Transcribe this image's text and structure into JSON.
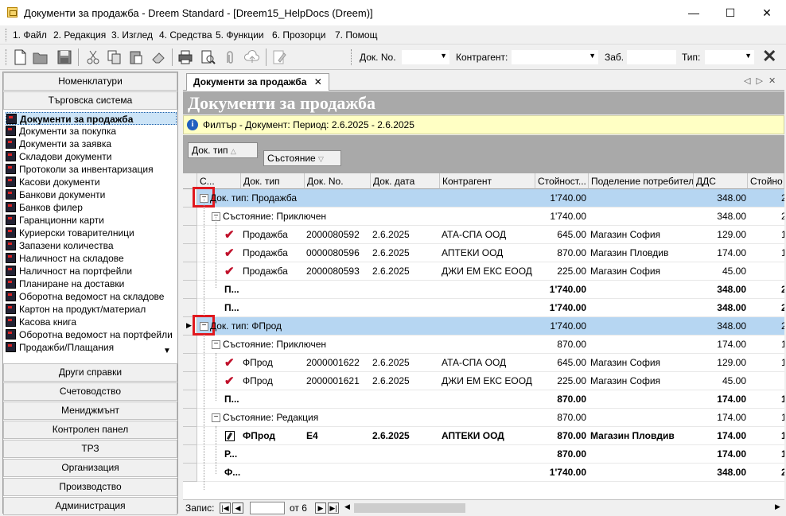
{
  "window": {
    "title": "Документи за продажба - Dreem Standard - [Dreem15_HelpDocs (Dreem)]",
    "minimize": "—",
    "maximize": "☐",
    "close": "✕"
  },
  "menu": [
    "1. Файл",
    "2. Редакция",
    "3. Изглед",
    "4. Средства",
    "5. Функции",
    "6. Прозорци",
    "7. Помощ"
  ],
  "toolbar": {
    "icons": [
      "new-document-icon",
      "open-folder-icon",
      "save-icon",
      "cut-icon",
      "copy-icon",
      "paste-icon",
      "eraser-icon",
      "print-icon",
      "print-preview-icon",
      "attach-icon",
      "cloud-upload-icon",
      "edit-doc-icon"
    ],
    "doc_no_label": "Док. No.",
    "contragent_label": "Контрагент:",
    "zab_label": "Заб.",
    "type_label": "Тип:",
    "clear": "✕"
  },
  "leftpane": {
    "top_buttons": [
      "Номенклатури",
      "Търговска система"
    ],
    "items": [
      "Документи за продажба",
      "Документи за покупка",
      "Документи за заявка",
      "Складови документи",
      "Протоколи за инвентаризация",
      "Касови документи",
      "Банкови документи",
      "Банков филер",
      "Гаранционни карти",
      "Куриерски товарителници",
      "Запазени количества",
      "Наличност на складове",
      "Наличност на портфейли",
      "Планиране на доставки",
      "Оборотна ведомост на складове",
      "Картон на продукт/материал",
      "Касова книга",
      "Оборотна ведомост на портфейли",
      "Продажби/Плащания"
    ],
    "selected_index": 0,
    "bottom_buttons": [
      "Други справки",
      "Счетоводство",
      "Мениджмънт",
      "Контролен панел",
      "ТРЗ",
      "Организация",
      "Производство",
      "Администрация"
    ]
  },
  "tab": {
    "label": "Документи за продажба",
    "close": "✕",
    "nav": "◁ ▷ ✕"
  },
  "page_title": "Документи за продажба",
  "filter": {
    "icon": "i",
    "text": "Филтър - Документ: Период: 2.6.2025 - 2.6.2025"
  },
  "group_panel": {
    "group1": "Док. тип",
    "group2": "Състояние"
  },
  "grid": {
    "columns": [
      "С...",
      "Док. тип",
      "Док. No.",
      "Док. дата",
      "Контрагент",
      "Стойност...",
      "Поделение потребител",
      "ДДС",
      "Стойно"
    ],
    "groups": [
      {
        "label": "Док. тип: Продажба",
        "value": "1'740.00",
        "vat": "348.00",
        "extra": "2",
        "subgroups": [
          {
            "label": "Състояние: Приключен",
            "value": "1'740.00",
            "vat": "348.00",
            "extra": "2",
            "rows": [
              {
                "type": "Продажба",
                "no": "2000080592",
                "date": "2.6.2025",
                "client": "АТА-СПА ООД",
                "value": "645.00",
                "dept": "Магазин София",
                "vat": "129.00",
                "extra": "1"
              },
              {
                "type": "Продажба",
                "no": "0000080596",
                "date": "2.6.2025",
                "client": "АПТЕКИ ООД",
                "value": "870.00",
                "dept": "Магазин Пловдив",
                "vat": "174.00",
                "extra": "1"
              },
              {
                "type": "Продажба",
                "no": "2000080593",
                "date": "2.6.2025",
                "client": "ДЖИ ЕМ ЕКС ЕООД",
                "value": "225.00",
                "dept": "Магазин София",
                "vat": "45.00",
                "extra": ""
              }
            ],
            "footer": {
              "label": "П...",
              "value": "1'740.00",
              "vat": "348.00",
              "extra": "2"
            }
          }
        ],
        "footer": {
          "label": "П...",
          "value": "1'740.00",
          "vat": "348.00",
          "extra": "2"
        }
      },
      {
        "label": "Док. тип: ФПрод",
        "value": "1'740.00",
        "vat": "348.00",
        "extra": "2",
        "subgroups": [
          {
            "label": "Състояние: Приключен",
            "value": "870.00",
            "vat": "174.00",
            "extra": "1",
            "rows": [
              {
                "type": "ФПрод",
                "no": "2000001622",
                "date": "2.6.2025",
                "client": "АТА-СПА ООД",
                "value": "645.00",
                "dept": "Магазин София",
                "vat": "129.00",
                "extra": "1"
              },
              {
                "type": "ФПрод",
                "no": "2000001621",
                "date": "2.6.2025",
                "client": "ДЖИ ЕМ ЕКС ЕООД",
                "value": "225.00",
                "dept": "Магазин София",
                "vat": "45.00",
                "extra": ""
              }
            ],
            "footer": {
              "label": "П...",
              "value": "870.00",
              "vat": "174.00",
              "extra": "1"
            }
          },
          {
            "label": "Състояние: Редакция",
            "value": "870.00",
            "vat": "174.00",
            "extra": "1",
            "rows": [
              {
                "type": "ФПрод",
                "no": "Е4",
                "date": "2.6.2025",
                "client": "АПТЕКИ ООД",
                "value": "870.00",
                "dept": "Магазин Пловдив",
                "vat": "174.00",
                "extra": "1"
              }
            ],
            "footer": {
              "label": "Р...",
              "value": "870.00",
              "vat": "174.00",
              "extra": "1"
            }
          }
        ],
        "footer": {
          "label": "Ф...",
          "value": "1'740.00",
          "vat": "348.00",
          "extra": "2"
        }
      }
    ]
  },
  "status": {
    "label": "Запис:",
    "current": "",
    "of": "от 6"
  }
}
